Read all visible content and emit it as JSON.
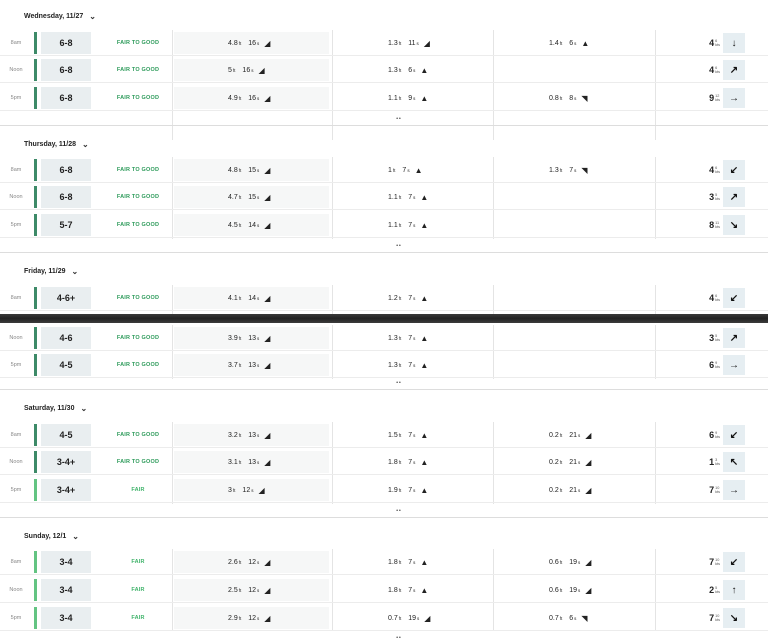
{
  "colors": {
    "good": "#2e9b5b",
    "fair": "#3fb36a",
    "bar_good": "#3d8a68",
    "bar_fair": "#63c482"
  },
  "days": [
    {
      "label": "Wednesday, 11/27",
      "chevron": "⌄",
      "dots": "••",
      "rows": [
        {
          "time": "8am",
          "height": "6-8",
          "rating": "FAIR TO GOOD",
          "level": "good",
          "s1": {
            "ht": "4.8",
            "per": "16",
            "dir": "◢"
          },
          "s2": {
            "ht": "1.3",
            "per": "11",
            "dir": "◢"
          },
          "s3": {
            "ht": "1.4",
            "per": "6",
            "dir": "▲"
          },
          "wind": {
            "kn": "4",
            "g": "6",
            "u": "kts"
          },
          "winddir": "↓"
        },
        {
          "time": "Noon",
          "height": "6-8",
          "rating": "FAIR TO GOOD",
          "level": "good",
          "s1": {
            "ht": "5",
            "per": "16",
            "dir": "◢"
          },
          "s2": {
            "ht": "1.3",
            "per": "6",
            "dir": "▲"
          },
          "s3": null,
          "wind": {
            "kn": "4",
            "g": "6",
            "u": "kts"
          },
          "winddir": "↗"
        },
        {
          "time": "5pm",
          "height": "6-8",
          "rating": "FAIR TO GOOD",
          "level": "good",
          "s1": {
            "ht": "4.9",
            "per": "16",
            "dir": "◢"
          },
          "s2": {
            "ht": "1.1",
            "per": "9",
            "dir": "▲"
          },
          "s3": {
            "ht": "0.8",
            "per": "8",
            "dir": "◥"
          },
          "wind": {
            "kn": "9",
            "g": "12",
            "u": "kts"
          },
          "winddir": "→"
        }
      ]
    },
    {
      "label": "Thursday, 11/28",
      "chevron": "⌄",
      "dots": "••",
      "rows": [
        {
          "time": "8am",
          "height": "6-8",
          "rating": "FAIR TO GOOD",
          "level": "good",
          "s1": {
            "ht": "4.8",
            "per": "15",
            "dir": "◢"
          },
          "s2": {
            "ht": "1",
            "per": "7",
            "dir": "▲"
          },
          "s3": {
            "ht": "1.3",
            "per": "7",
            "dir": "◥"
          },
          "wind": {
            "kn": "4",
            "g": "6",
            "u": "kts"
          },
          "winddir": "↙"
        },
        {
          "time": "Noon",
          "height": "6-8",
          "rating": "FAIR TO GOOD",
          "level": "good",
          "s1": {
            "ht": "4.7",
            "per": "15",
            "dir": "◢"
          },
          "s2": {
            "ht": "1.1",
            "per": "7",
            "dir": "▲"
          },
          "s3": null,
          "wind": {
            "kn": "3",
            "g": "5",
            "u": "kts"
          },
          "winddir": "↗"
        },
        {
          "time": "5pm",
          "height": "5-7",
          "rating": "FAIR TO GOOD",
          "level": "good",
          "s1": {
            "ht": "4.5",
            "per": "14",
            "dir": "◢"
          },
          "s2": {
            "ht": "1.1",
            "per": "7",
            "dir": "▲"
          },
          "s3": null,
          "wind": {
            "kn": "8",
            "g": "11",
            "u": "kts"
          },
          "winddir": "↘"
        }
      ]
    },
    {
      "label": "Friday, 11/29",
      "chevron": "⌄",
      "dots": "••",
      "rows": [
        {
          "time": "8am",
          "height": "4-6+",
          "rating": "FAIR TO GOOD",
          "level": "good",
          "s1": {
            "ht": "4.1",
            "per": "14",
            "dir": "◢"
          },
          "s2": {
            "ht": "1.2",
            "per": "7",
            "dir": "▲"
          },
          "s3": null,
          "wind": {
            "kn": "4",
            "g": "6",
            "u": "kts"
          },
          "winddir": "↙"
        },
        {
          "time": "Noon",
          "height": "4-6",
          "rating": "FAIR TO GOOD",
          "level": "good",
          "s1": {
            "ht": "3.9",
            "per": "13",
            "dir": "◢"
          },
          "s2": {
            "ht": "1.3",
            "per": "7",
            "dir": "▲"
          },
          "s3": null,
          "wind": {
            "kn": "3",
            "g": "5",
            "u": "kts"
          },
          "winddir": "↗"
        },
        {
          "time": "5pm",
          "height": "4-5",
          "rating": "FAIR TO GOOD",
          "level": "good",
          "s1": {
            "ht": "3.7",
            "per": "13",
            "dir": "◢"
          },
          "s2": {
            "ht": "1.3",
            "per": "7",
            "dir": "▲"
          },
          "s3": null,
          "wind": {
            "kn": "6",
            "g": "9",
            "u": "kts"
          },
          "winddir": "→"
        }
      ]
    },
    {
      "label": "Saturday, 11/30",
      "chevron": "⌄",
      "dots": "••",
      "rows": [
        {
          "time": "8am",
          "height": "4-5",
          "rating": "FAIR TO GOOD",
          "level": "good",
          "s1": {
            "ht": "3.2",
            "per": "13",
            "dir": "◢"
          },
          "s2": {
            "ht": "1.5",
            "per": "7",
            "dir": "▲"
          },
          "s3": {
            "ht": "0.2",
            "per": "21",
            "dir": "◢"
          },
          "wind": {
            "kn": "6",
            "g": "9",
            "u": "kts"
          },
          "winddir": "↙"
        },
        {
          "time": "Noon",
          "height": "3-4+",
          "rating": "FAIR TO GOOD",
          "level": "good",
          "s1": {
            "ht": "3.1",
            "per": "13",
            "dir": "◢"
          },
          "s2": {
            "ht": "1.8",
            "per": "7",
            "dir": "▲"
          },
          "s3": {
            "ht": "0.2",
            "per": "21",
            "dir": "◢"
          },
          "wind": {
            "kn": "1",
            "g": "3",
            "u": "kts"
          },
          "winddir": "↖"
        },
        {
          "time": "5pm",
          "height": "3-4+",
          "rating": "FAIR",
          "level": "fair",
          "s1": {
            "ht": "3",
            "per": "12",
            "dir": "◢"
          },
          "s2": {
            "ht": "1.9",
            "per": "7",
            "dir": "▲"
          },
          "s3": {
            "ht": "0.2",
            "per": "21",
            "dir": "◢"
          },
          "wind": {
            "kn": "7",
            "g": "10",
            "u": "kts"
          },
          "winddir": "→"
        }
      ]
    },
    {
      "label": "Sunday, 12/1",
      "chevron": "⌄",
      "dots": "••",
      "rows": [
        {
          "time": "8am",
          "height": "3-4",
          "rating": "FAIR",
          "level": "fair",
          "s1": {
            "ht": "2.6",
            "per": "12",
            "dir": "◢"
          },
          "s2": {
            "ht": "1.8",
            "per": "7",
            "dir": "▲"
          },
          "s3": {
            "ht": "0.6",
            "per": "19",
            "dir": "◢"
          },
          "wind": {
            "kn": "7",
            "g": "10",
            "u": "kts"
          },
          "winddir": "↙"
        },
        {
          "time": "Noon",
          "height": "3-4",
          "rating": "FAIR",
          "level": "fair",
          "s1": {
            "ht": "2.5",
            "per": "12",
            "dir": "◢"
          },
          "s2": {
            "ht": "1.8",
            "per": "7",
            "dir": "▲"
          },
          "s3": {
            "ht": "0.6",
            "per": "19",
            "dir": "◢"
          },
          "wind": {
            "kn": "2",
            "g": "5",
            "u": "kts"
          },
          "winddir": "↑"
        },
        {
          "time": "5pm",
          "height": "3-4",
          "rating": "FAIR",
          "level": "fair",
          "s1": {
            "ht": "2.9",
            "per": "12",
            "dir": "◢"
          },
          "s2": {
            "ht": "0.7",
            "per": "19",
            "dir": "◢"
          },
          "s3": {
            "ht": "0.7",
            "per": "6",
            "dir": "◥"
          },
          "wind": {
            "kn": "7",
            "g": "10",
            "u": "kts"
          },
          "winddir": "↘"
        }
      ]
    }
  ]
}
